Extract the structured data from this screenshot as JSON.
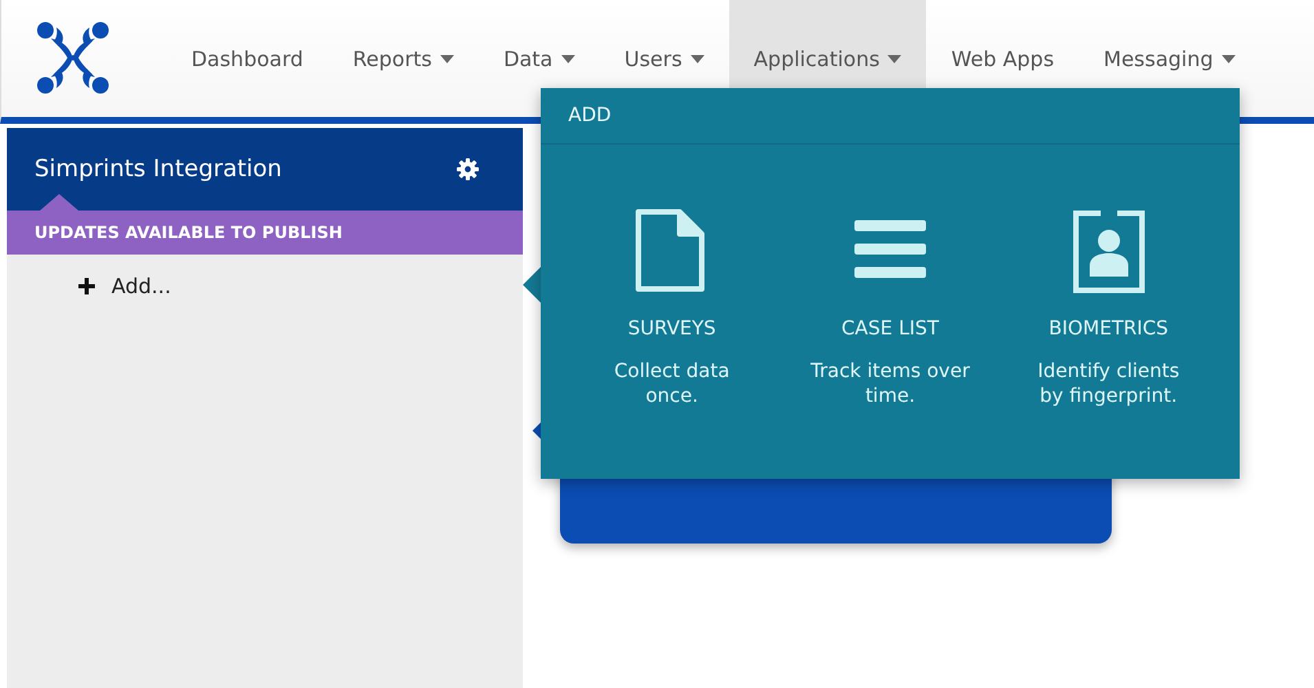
{
  "nav": {
    "items": [
      {
        "label": "Dashboard",
        "dropdown": false,
        "selected": false
      },
      {
        "label": "Reports",
        "dropdown": true,
        "selected": false
      },
      {
        "label": "Data",
        "dropdown": true,
        "selected": false
      },
      {
        "label": "Users",
        "dropdown": true,
        "selected": false
      },
      {
        "label": "Applications",
        "dropdown": true,
        "selected": true
      },
      {
        "label": "Web Apps",
        "dropdown": false,
        "selected": false
      },
      {
        "label": "Messaging",
        "dropdown": true,
        "selected": false
      }
    ]
  },
  "sidebar": {
    "title": "Simprints Integration",
    "banner": "UPDATES AVAILABLE TO PUBLISH",
    "add_label": "Add..."
  },
  "add_menu": {
    "header": "ADD",
    "options": [
      {
        "kind": "document",
        "title": "SURVEYS",
        "description": "Collect data once."
      },
      {
        "kind": "list",
        "title": "CASE LIST",
        "description": "Track items over time."
      },
      {
        "kind": "badge",
        "title": "BIOMETRICS",
        "description": "Identify clients by fingerprint."
      }
    ]
  }
}
